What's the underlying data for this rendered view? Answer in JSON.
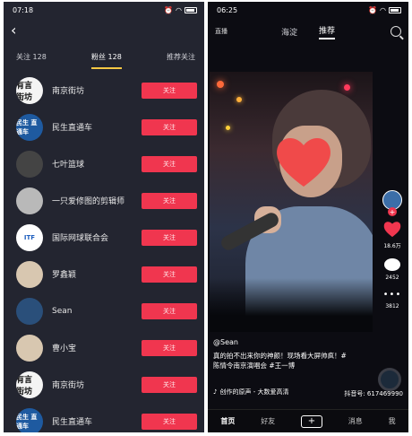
{
  "left": {
    "status": {
      "time": "07:18"
    },
    "tabs": [
      {
        "label": "关注 128"
      },
      {
        "label": "粉丝 128"
      },
      {
        "label": "推荐关注"
      }
    ],
    "rows": [
      {
        "name": "南京街坊",
        "avatar_text": "有言 街坊",
        "button": "关注"
      },
      {
        "name": "民生直通车",
        "avatar_text": "民生 直通车",
        "button": "关注"
      },
      {
        "name": "七叶篮球",
        "avatar_text": "",
        "button": "关注"
      },
      {
        "name": "一只爱修图的剪辑师",
        "avatar_text": "",
        "button": "关注"
      },
      {
        "name": "国际网球联合会",
        "avatar_text": "ITF",
        "button": "关注"
      },
      {
        "name": "罗鑫颖",
        "avatar_text": "",
        "button": "关注"
      },
      {
        "name": "Sean",
        "avatar_text": "",
        "button": "关注"
      },
      {
        "name": "曹小宝",
        "avatar_text": "",
        "button": "关注"
      },
      {
        "name": "南京街坊",
        "avatar_text": "有言 街坊",
        "button": "关注"
      },
      {
        "name": "民生直通车",
        "avatar_text": "民生 直通车",
        "button": "关注"
      }
    ],
    "colors": {
      "bg": "#232530",
      "follow_button": "#f0364f",
      "tab_underline": "#f7c844"
    }
  },
  "right": {
    "status": {
      "time": "06:25"
    },
    "nav": {
      "live": "直播",
      "tab1": "海淀",
      "tab2": "推荐"
    },
    "side": {
      "likes": "18.6万",
      "comments": "2452",
      "shares": "3812"
    },
    "video": {
      "user": "@Sean",
      "desc": "真的拍不出来你的神颜！现场看大屏帅疯！#陈情令南京演唱会 #王一博",
      "music": "创作的原声 - 大数爱高清",
      "douyin_id": "抖音号: 617469990"
    },
    "bottom": {
      "home": "首页",
      "friends": "好友",
      "create": "+",
      "messages": "消息",
      "me": "我"
    },
    "colors": {
      "accent": "#f0364f"
    }
  }
}
